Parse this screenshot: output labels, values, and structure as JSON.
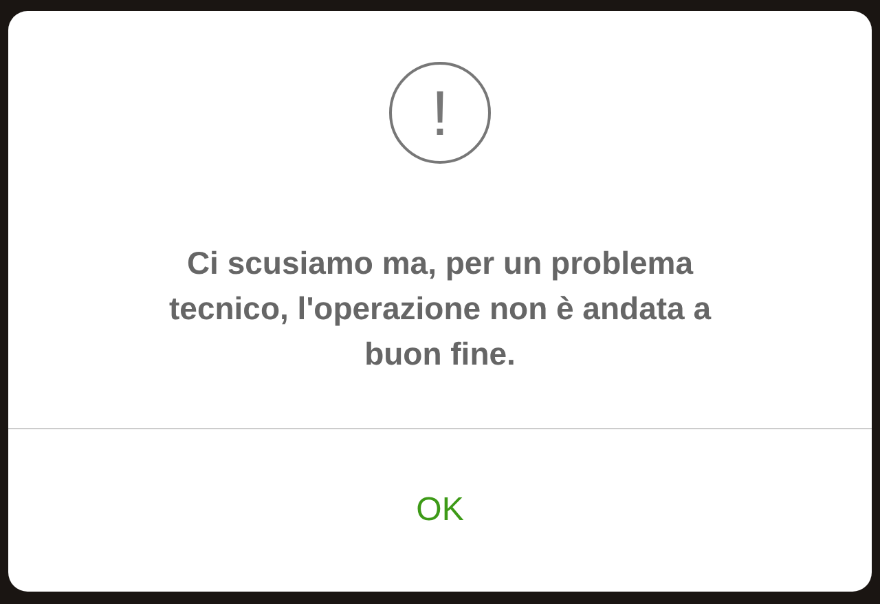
{
  "dialog": {
    "icon_glyph": "!",
    "message": "Ci scusiamo ma, per un problema tecnico, l'operazione non è andata a buon fine.",
    "buttons": [
      "OK"
    ]
  }
}
